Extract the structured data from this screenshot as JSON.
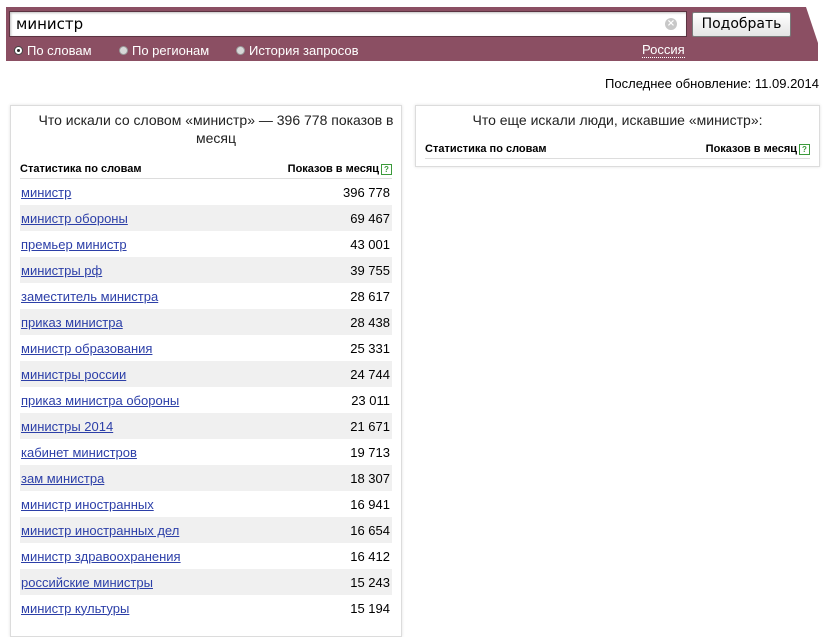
{
  "search": {
    "value": "министр",
    "submit_label": "Подобрать"
  },
  "modes": [
    {
      "label": "По словам",
      "checked": true
    },
    {
      "label": "По регионам",
      "checked": false
    },
    {
      "label": "История запросов",
      "checked": false
    }
  ],
  "region": "Россия",
  "last_update": "Последнее обновление: 11.09.2014",
  "left_panel": {
    "title": "Что искали со словом «министр» — 396 778 показов в месяц",
    "col_phrase": "Статистика по словам",
    "col_count": "Показов в месяц",
    "rows": [
      {
        "phrase": "министр",
        "count": "396 778"
      },
      {
        "phrase": "министр обороны",
        "count": "69 467"
      },
      {
        "phrase": "премьер министр",
        "count": "43 001"
      },
      {
        "phrase": "министры рф",
        "count": "39 755"
      },
      {
        "phrase": "заместитель министра",
        "count": "28 617"
      },
      {
        "phrase": "приказ министра",
        "count": "28 438"
      },
      {
        "phrase": "министр образования",
        "count": "25 331"
      },
      {
        "phrase": "министры россии",
        "count": "24 744"
      },
      {
        "phrase": "приказ министра обороны",
        "count": "23 011"
      },
      {
        "phrase": "министры 2014",
        "count": "21 671"
      },
      {
        "phrase": "кабинет министров",
        "count": "19 713"
      },
      {
        "phrase": "зам министра",
        "count": "18 307"
      },
      {
        "phrase": "министр иностранных",
        "count": "16 941"
      },
      {
        "phrase": "министр иностранных дел",
        "count": "16 654"
      },
      {
        "phrase": "министр здравоохранения",
        "count": "16 412"
      },
      {
        "phrase": "российские министры",
        "count": "15 243"
      },
      {
        "phrase": "министр культуры",
        "count": "15 194"
      }
    ]
  },
  "right_panel": {
    "title": "Что еще искали люди, искавшие «министр»:",
    "col_phrase": "Статистика по словам",
    "col_count": "Показов в месяц"
  },
  "colors": {
    "band": "#8b4f63",
    "link": "#2c3fa8",
    "row_alt": "#f0f0f0",
    "help": "#3b9a3b"
  },
  "icons": {
    "clear": "clear-icon",
    "help": "help-icon"
  }
}
